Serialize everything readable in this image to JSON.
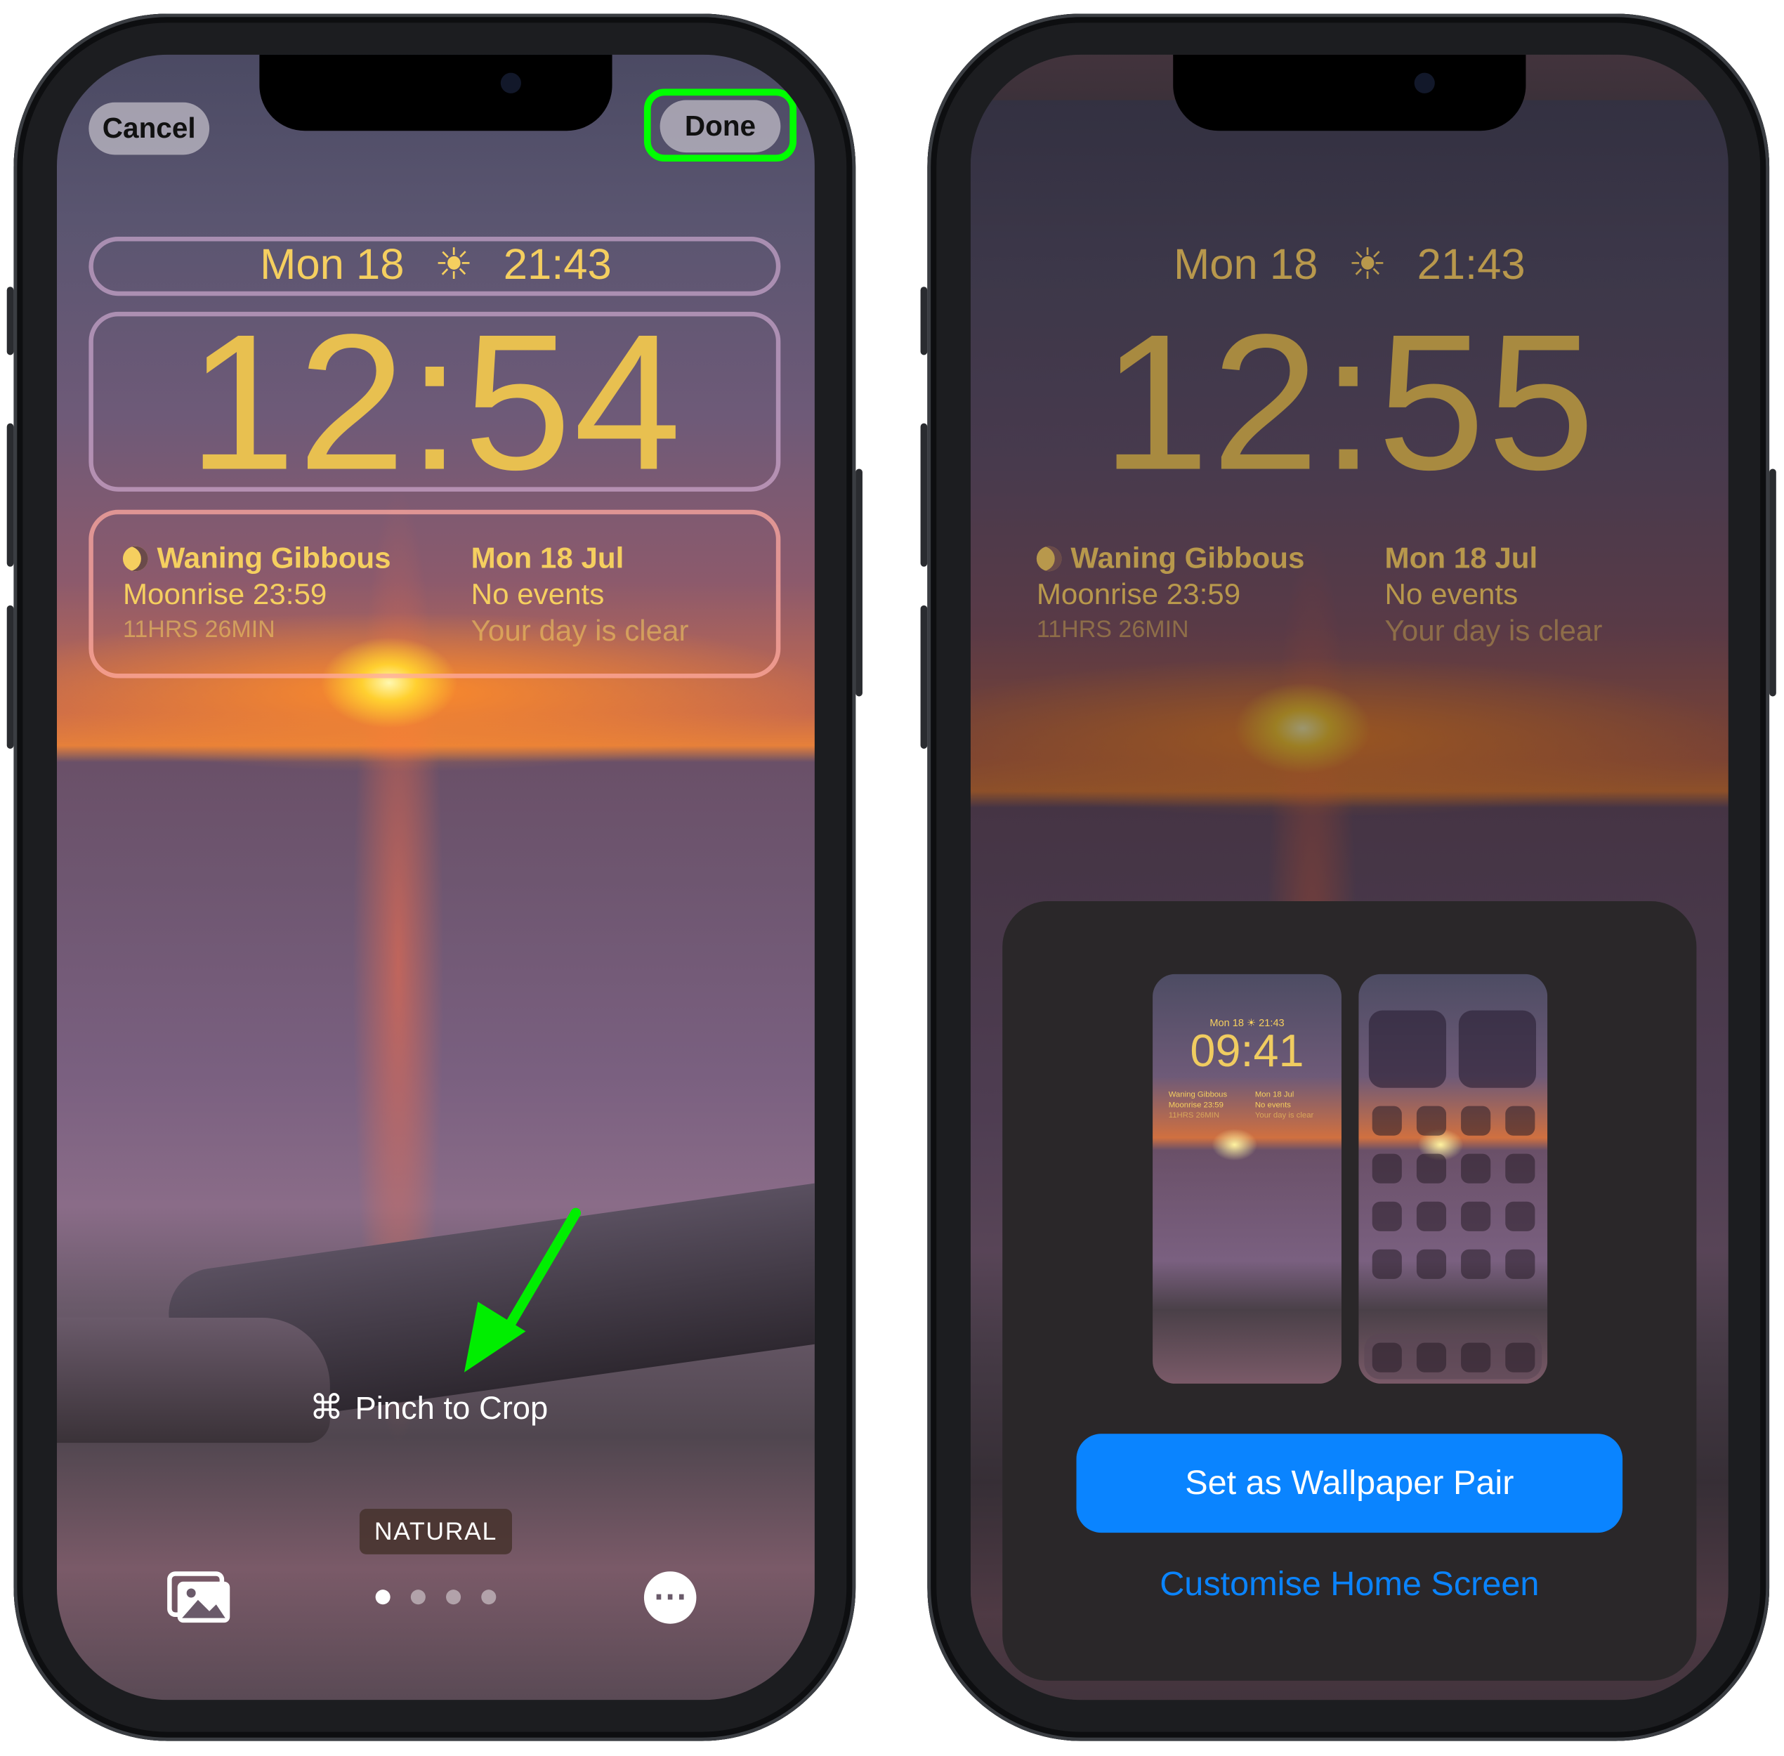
{
  "left_phone": {
    "cancel_label": "Cancel",
    "done_label": "Done",
    "date_row": {
      "date": "Mon 18",
      "sunset_icon": "sunset-icon",
      "time": "21:43"
    },
    "clock": "12:54",
    "widgets": {
      "moon": {
        "title": "Waning Gibbous",
        "line2": "Moonrise 23:59",
        "line3": "11HRS 26MIN"
      },
      "calendar": {
        "title": "Mon 18 Jul",
        "line2": "No events",
        "line3": "Your day is clear"
      }
    },
    "hint": "Pinch to Crop",
    "filter_label": "NATURAL",
    "page_dots": {
      "count": 4,
      "active": 1
    },
    "highlight_color": "#00ff00"
  },
  "right_phone": {
    "date_row": {
      "date": "Mon 18",
      "time": "21:43"
    },
    "clock": "12:55",
    "widgets": {
      "moon": {
        "title": "Waning Gibbous",
        "line2": "Moonrise 23:59",
        "line3": "11HRS 26MIN"
      },
      "calendar": {
        "title": "Mon 18 Jul",
        "line2": "No events",
        "line3": "Your day is clear"
      }
    },
    "preview": {
      "date": "Mon 18",
      "time": "21:43",
      "clock": "09:41",
      "moon_title": "Waning Gibbous",
      "moon_line2": "Moonrise 23:59",
      "moon_line3": "11HRS 26MIN",
      "cal_title": "Mon 18 Jul",
      "cal_line2": "No events",
      "cal_line3": "Your day is clear"
    },
    "primary_button": "Set as Wallpaper Pair",
    "secondary_link": "Customise Home Screen",
    "accent_color": "#0a84ff"
  }
}
